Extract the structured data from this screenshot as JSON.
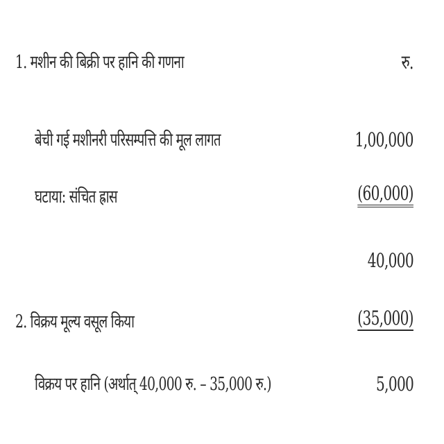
{
  "rows": [
    {
      "label": "1. मशीन की बिक्री पर हानि की गणना",
      "amount": "रु."
    },
    {
      "label": "बेची गई मशीनरी परिसम्पत्ति की मूल लागत",
      "amount": "1,00,000"
    },
    {
      "label": "घटाया: संचित ह्रास",
      "amount": "(60,000)"
    },
    {
      "label": "",
      "amount": "40,000"
    },
    {
      "label": "2. विक्रय मूल्य वसूल किया",
      "amount": "(35,000)"
    },
    {
      "label": "विक्रय पर हानि (अर्थात् 40,000 रु. – 35,000 रु.)",
      "amount": "5,000"
    }
  ]
}
